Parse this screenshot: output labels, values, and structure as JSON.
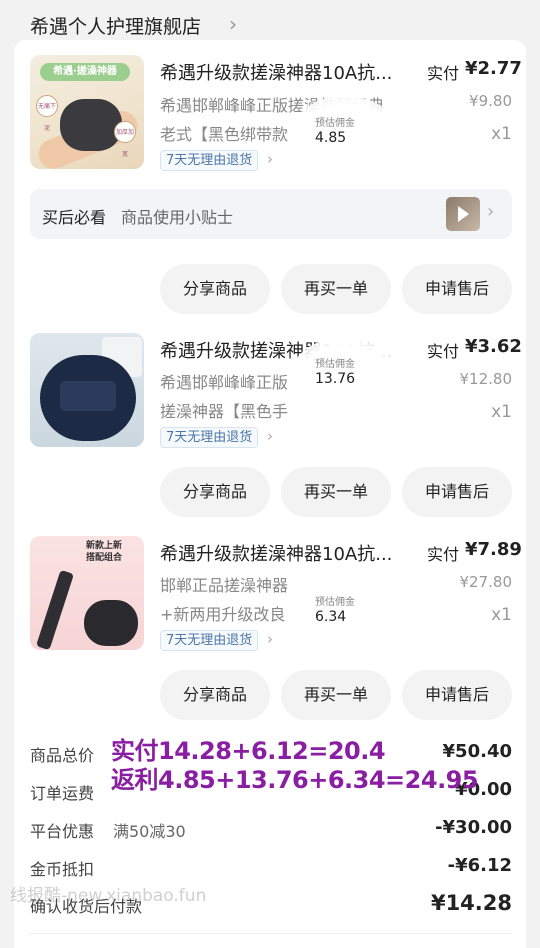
{
  "shop": {
    "name": "希遇个人护理旗舰店",
    "chevron": "›"
  },
  "items": [
    {
      "title": "希遇升级款搓澡神器10A抗...",
      "paid_label": "实付",
      "paid_value": "¥2.77",
      "desc1": "希遇邯郸峰峰正版搓澡神器经典",
      "desc2": "老式【黑色绑带款",
      "orig_price": "¥9.80",
      "qty": "x1",
      "return_tag": "7天无理由退货",
      "commission_label": "预估佣金",
      "commission_value": "4.85",
      "image": {
        "banner": "希遇·搓澡神器",
        "dot_left": "无痛下泥",
        "dot_right": "加厚加宽"
      }
    },
    {
      "title": "希遇升级款搓澡神器10A抗...",
      "paid_label": "实付",
      "paid_value": "¥3.62",
      "desc1": "希遇邯郸峰峰正版",
      "desc2": "搓澡神器【黑色手",
      "orig_price": "¥12.80",
      "qty": "x1",
      "return_tag": "7天无理由退货",
      "commission_label": "预估佣金",
      "commission_value": "13.76"
    },
    {
      "title": "希遇升级款搓澡神器10A抗...",
      "paid_label": "实付",
      "paid_value": "¥7.89",
      "desc1": "邯郸正品搓澡神器",
      "desc2": "+新两用升级改良",
      "orig_price": "¥27.80",
      "qty": "x1",
      "return_tag": "7天无理由退货",
      "commission_label": "预估佣金",
      "commission_value": "6.34",
      "image": {
        "caption_line1": "新款上新",
        "caption_line2": "搭配组合"
      }
    }
  ],
  "tips": {
    "title": "买后必看",
    "subtitle": "商品使用小贴士"
  },
  "buttons": {
    "share": "分享商品",
    "rebuy": "再买一单",
    "after_sale": "申请售后"
  },
  "summary": {
    "total_label": "商品总价",
    "total_value": "¥50.40",
    "shipping_label": "订单运费",
    "shipping_value": "¥0.00",
    "platform_label": "平台优惠",
    "platform_promo": "满50减30",
    "platform_value": "-¥30.00",
    "coin_label": "金币抵扣",
    "coin_value": "-¥6.12",
    "confirm_label": "确认收货后付款",
    "confirm_value": "¥14.28"
  },
  "annotation": {
    "line1": "实付14.28+6.12=20.4",
    "line2": "返利4.85+13.76+6.34=24.95"
  },
  "watermark": "线报酷-new.xianbao.fun",
  "colors": {
    "annotation": "#8a1ea3",
    "tag_text": "#4a76a8",
    "button_bg": "#f3f3f3"
  }
}
